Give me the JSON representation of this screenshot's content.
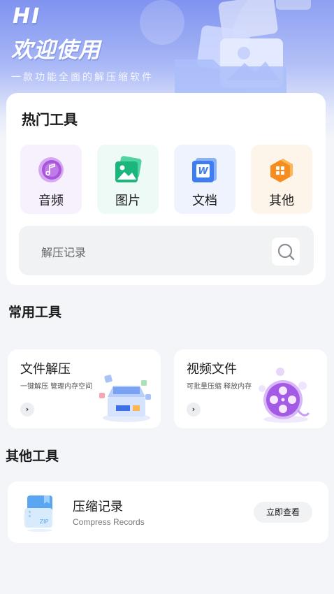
{
  "header": {
    "greeting": "HI",
    "welcome": "欢迎使用",
    "subtitle": "一款功能全面的解压缩软件"
  },
  "hot_tools": {
    "title": "热门工具",
    "items": [
      {
        "label": "音频",
        "icon": "music-note-icon"
      },
      {
        "label": "图片",
        "icon": "image-icon"
      },
      {
        "label": "文档",
        "icon": "word-document-icon"
      },
      {
        "label": "其他",
        "icon": "app-grid-icon"
      }
    ],
    "search": {
      "label": "解压记录",
      "icon": "search-icon"
    }
  },
  "common_tools": {
    "title": "常用工具",
    "items": [
      {
        "title": "文件解压",
        "desc": "一键解压 管理内存空间",
        "icon": "box-unpack-icon"
      },
      {
        "title": "视频文件",
        "desc": "可批量压缩 释放内存",
        "icon": "film-reel-icon"
      }
    ]
  },
  "other_tools": {
    "title": "其他工具",
    "record": {
      "title": "压缩记录",
      "subtitle": "Compress Records",
      "button": "立即查看",
      "icon": "zip-file-icon"
    }
  },
  "colors": {
    "hero_top": "#7f93f0",
    "audio_tile": "#f7f0fd",
    "image_tile": "#eefaf5",
    "doc_tile": "#eef3fd",
    "other_tile": "#fdf4ea",
    "page_bg": "#f4f5f8"
  }
}
